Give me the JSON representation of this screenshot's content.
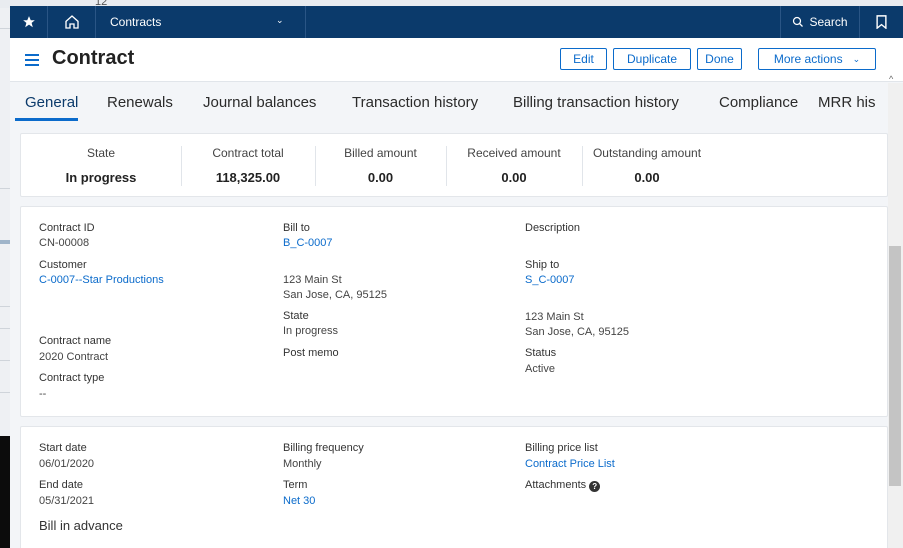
{
  "background": {
    "top_text": "12"
  },
  "nav": {
    "app": "Contracts",
    "search": "Search"
  },
  "header": {
    "title": "Contract",
    "edit": "Edit",
    "duplicate": "Duplicate",
    "done": "Done",
    "more_actions": "More actions"
  },
  "tabs": [
    "General",
    "Renewals",
    "Journal balances",
    "Transaction history",
    "Billing transaction history",
    "Compliance",
    "MRR his"
  ],
  "summary": [
    {
      "label": "State",
      "value": "In progress"
    },
    {
      "label": "Contract total",
      "value": "118,325.00"
    },
    {
      "label": "Billed amount",
      "value": "0.00"
    },
    {
      "label": "Received amount",
      "value": "0.00"
    },
    {
      "label": "Outstanding amount",
      "value": "0.00"
    }
  ],
  "details": {
    "contract_id_label": "Contract ID",
    "contract_id": "CN-00008",
    "customer_label": "Customer",
    "customer": "C-0007--Star Productions",
    "contract_name_label": "Contract name",
    "contract_name": "2020 Contract",
    "contract_type_label": "Contract type",
    "contract_type": "--",
    "bill_to_label": "Bill to",
    "bill_to": "B_C-0007",
    "bill_to_addr1": "123 Main St",
    "bill_to_addr2": "San Jose, CA, 95125",
    "state_label": "State",
    "state": "In progress",
    "post_memo_label": "Post memo",
    "description_label": "Description",
    "ship_to_label": "Ship to",
    "ship_to": "S_C-0007",
    "ship_to_addr1": "123 Main St",
    "ship_to_addr2": "San Jose, CA, 95125",
    "status_label": "Status",
    "status": "Active"
  },
  "billing": {
    "start_date_label": "Start date",
    "start_date": "06/01/2020",
    "end_date_label": "End date",
    "end_date": "05/31/2021",
    "bill_in_advance": "Bill in advance",
    "billing_frequency_label": "Billing frequency",
    "billing_frequency": "Monthly",
    "term_label": "Term",
    "term": "Net 30",
    "billing_price_list_label": "Billing price list",
    "billing_price_list": "Contract Price List",
    "attachments_label": "Attachments"
  }
}
